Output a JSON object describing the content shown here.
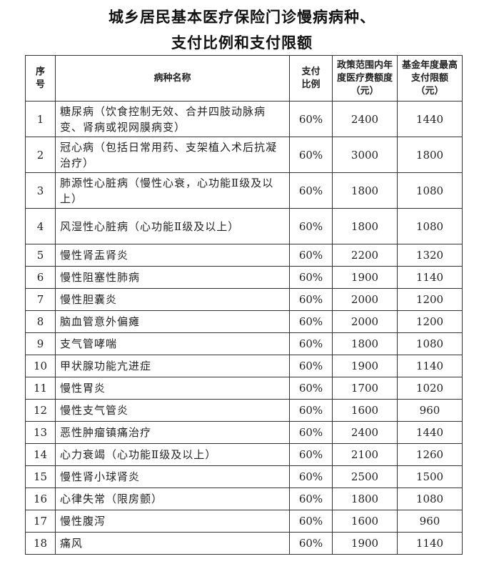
{
  "title": {
    "line1": "城乡居民基本医疗保险门诊慢病病种、",
    "line2": "支付比例和支付限额"
  },
  "headers": {
    "index": "序号",
    "name": "病种名称",
    "ratio": "支付比例",
    "policy": "政策范围内年度医疗费额度（元）",
    "limit": "基金年度最高支付限额（元）"
  },
  "rows": [
    {
      "index": "1",
      "name": "糖尿病（饮食控制无效、合并四肢动脉病变、肾病或视网膜病变）",
      "ratio": "60%",
      "policy": "2400",
      "limit": "1440"
    },
    {
      "index": "2",
      "name": "冠心病（包括日常用药、支架植入术后抗凝治疗）",
      "ratio": "60%",
      "policy": "3000",
      "limit": "1800"
    },
    {
      "index": "3",
      "name": "肺源性心脏病（慢性心衰，心功能Ⅱ级及以上）",
      "ratio": "60%",
      "policy": "1800",
      "limit": "1080"
    },
    {
      "index": "4",
      "name": "风湿性心脏病（心功能Ⅱ级及以上）",
      "ratio": "60%",
      "policy": "1800",
      "limit": "1080"
    },
    {
      "index": "5",
      "name": "慢性肾盂肾炎",
      "ratio": "60%",
      "policy": "2200",
      "limit": "1320"
    },
    {
      "index": "6",
      "name": "慢性阻塞性肺病",
      "ratio": "60%",
      "policy": "1900",
      "limit": "1140"
    },
    {
      "index": "7",
      "name": "慢性胆囊炎",
      "ratio": "60%",
      "policy": "2000",
      "limit": "1200"
    },
    {
      "index": "8",
      "name": "脑血管意外偏瘫",
      "ratio": "60%",
      "policy": "2000",
      "limit": "1200"
    },
    {
      "index": "9",
      "name": "支气管哮喘",
      "ratio": "60%",
      "policy": "1800",
      "limit": "1080"
    },
    {
      "index": "10",
      "name": "甲状腺功能亢进症",
      "ratio": "60%",
      "policy": "1900",
      "limit": "1140"
    },
    {
      "index": "11",
      "name": "慢性胃炎",
      "ratio": "60%",
      "policy": "1700",
      "limit": "1020"
    },
    {
      "index": "12",
      "name": "慢性支气管炎",
      "ratio": "60%",
      "policy": "1600",
      "limit": "960"
    },
    {
      "index": "13",
      "name": "恶性肿瘤镇痛治疗",
      "ratio": "60%",
      "policy": "2400",
      "limit": "1440"
    },
    {
      "index": "14",
      "name": "心力衰竭（心功能Ⅱ级及以上）",
      "ratio": "60%",
      "policy": "2100",
      "limit": "1260"
    },
    {
      "index": "15",
      "name": "慢性肾小球肾炎",
      "ratio": "60%",
      "policy": "2500",
      "limit": "1500"
    },
    {
      "index": "16",
      "name": "心律失常（限房颤）",
      "ratio": "60%",
      "policy": "1800",
      "limit": "1080"
    },
    {
      "index": "17",
      "name": "慢性腹泻",
      "ratio": "60%",
      "policy": "1600",
      "limit": "960"
    },
    {
      "index": "18",
      "name": "痛风",
      "ratio": "60%",
      "policy": "1900",
      "limit": "1140"
    }
  ]
}
